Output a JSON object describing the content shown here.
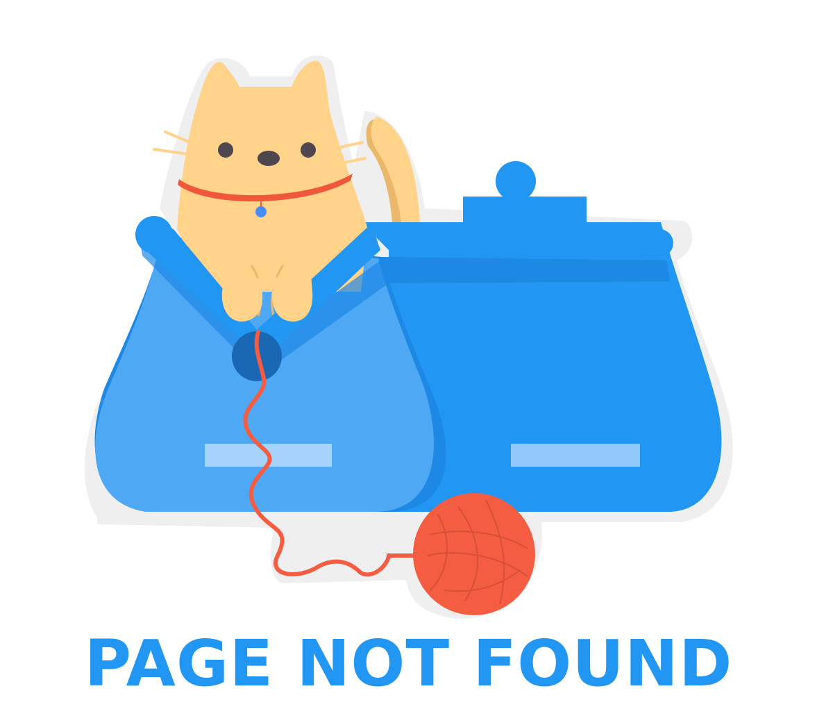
{
  "page": {
    "headline": "PAGE NOT FOUND"
  },
  "illustration": {
    "subject": "cat-in-purse-with-yarn"
  },
  "colors": {
    "headline": "#2196f3",
    "purse_right": "#2196f3",
    "purse_left": "#4fa8f4",
    "purse_dark": "#1e88e5",
    "clasp_knob": "#1a68b3",
    "cat_fur": "#ffd38a",
    "cat_shadow": "#e9b86a",
    "yarn": "#f55d42",
    "collar": "#f0583c",
    "tag": "#4a8cf5",
    "eyes": "#4e4750",
    "halo": "#eeeeee",
    "label_left": "#a6d3fb",
    "label_right": "#90c9f9"
  }
}
